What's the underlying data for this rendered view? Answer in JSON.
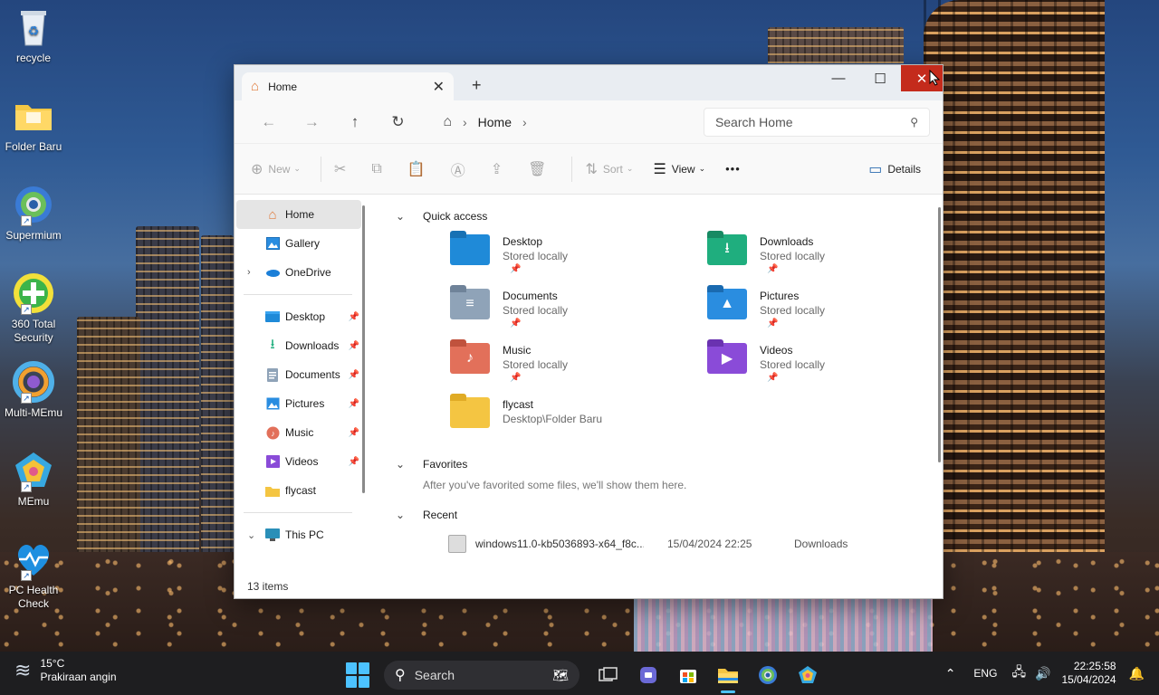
{
  "desktop": {
    "icons": [
      {
        "label": "recycle"
      },
      {
        "label": "Folder Baru"
      },
      {
        "label": "Supermium"
      },
      {
        "label": "360 Total Security"
      },
      {
        "label": "Multi-MEmu"
      },
      {
        "label": "MEmu"
      },
      {
        "label": "PC Health Check"
      }
    ]
  },
  "window": {
    "tab_title": "Home",
    "window_buttons": {
      "minimize": "—",
      "maximize": "☐",
      "close": "✕"
    },
    "address": {
      "location": "Home"
    },
    "search": {
      "placeholder": "Search Home"
    },
    "toolbar": {
      "new": "New",
      "sort": "Sort",
      "view": "View",
      "more": "•••",
      "details": "Details"
    },
    "sidebar": {
      "items": [
        {
          "label": "Home"
        },
        {
          "label": "Gallery"
        },
        {
          "label": "OneDrive"
        },
        {
          "label": "Desktop"
        },
        {
          "label": "Downloads"
        },
        {
          "label": "Documents"
        },
        {
          "label": "Pictures"
        },
        {
          "label": "Music"
        },
        {
          "label": "Videos"
        },
        {
          "label": "flycast"
        },
        {
          "label": "This PC"
        }
      ]
    },
    "quick_access": {
      "heading": "Quick access",
      "items": [
        {
          "name": "Desktop",
          "location": "Stored locally",
          "color": "#1f8ad8"
        },
        {
          "name": "Downloads",
          "location": "Stored locally",
          "color": "#1fae7e"
        },
        {
          "name": "Documents",
          "location": "Stored locally",
          "color": "#8fa3b8"
        },
        {
          "name": "Pictures",
          "location": "Stored locally",
          "color": "#2a8de0"
        },
        {
          "name": "Music",
          "location": "Stored locally",
          "color": "#e2705a"
        },
        {
          "name": "Videos",
          "location": "Stored locally",
          "color": "#8a4bd8"
        },
        {
          "name": "flycast",
          "location": "Desktop\\Folder Baru",
          "color": "#f4c542"
        }
      ]
    },
    "favorites": {
      "heading": "Favorites",
      "note": "After you've favorited some files, we'll show them here."
    },
    "recent": {
      "heading": "Recent",
      "files": [
        {
          "name": "windows11.0-kb5036893-x64_f8c...",
          "date": "15/04/2024 22:25",
          "location": "Downloads"
        }
      ]
    },
    "status": "13 items"
  },
  "taskbar": {
    "weather_temp": "15°C",
    "weather_desc": "Prakiraan angin",
    "search_label": "Search",
    "language": "ENG",
    "time": "22:25:58",
    "date": "15/04/2024"
  }
}
